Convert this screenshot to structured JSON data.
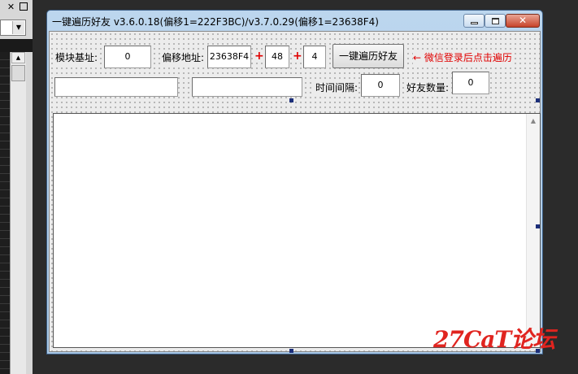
{
  "window": {
    "title": "一键遍历好友 v3.6.0.18(偏移1=222F3BC)/v3.7.0.29(偏移1=23638F4)",
    "close_symbol": "✕"
  },
  "form": {
    "module_base_label": "模块基址:",
    "module_base_value": "0",
    "offset_addr_label": "偏移地址:",
    "offset1_value": "23638F4",
    "plus_symbol": "+",
    "offset2_value": "48",
    "offset3_value": "4",
    "traverse_button": "一键遍历好友",
    "hint_text": "← 微信登录后点击遍历",
    "text_field_1_value": "",
    "text_field_2_value": "",
    "interval_label": "时间间隔:",
    "interval_value": "0",
    "friend_count_label": "好友数量:",
    "friend_count_value": "0"
  },
  "watermark": "27CaT论坛"
}
